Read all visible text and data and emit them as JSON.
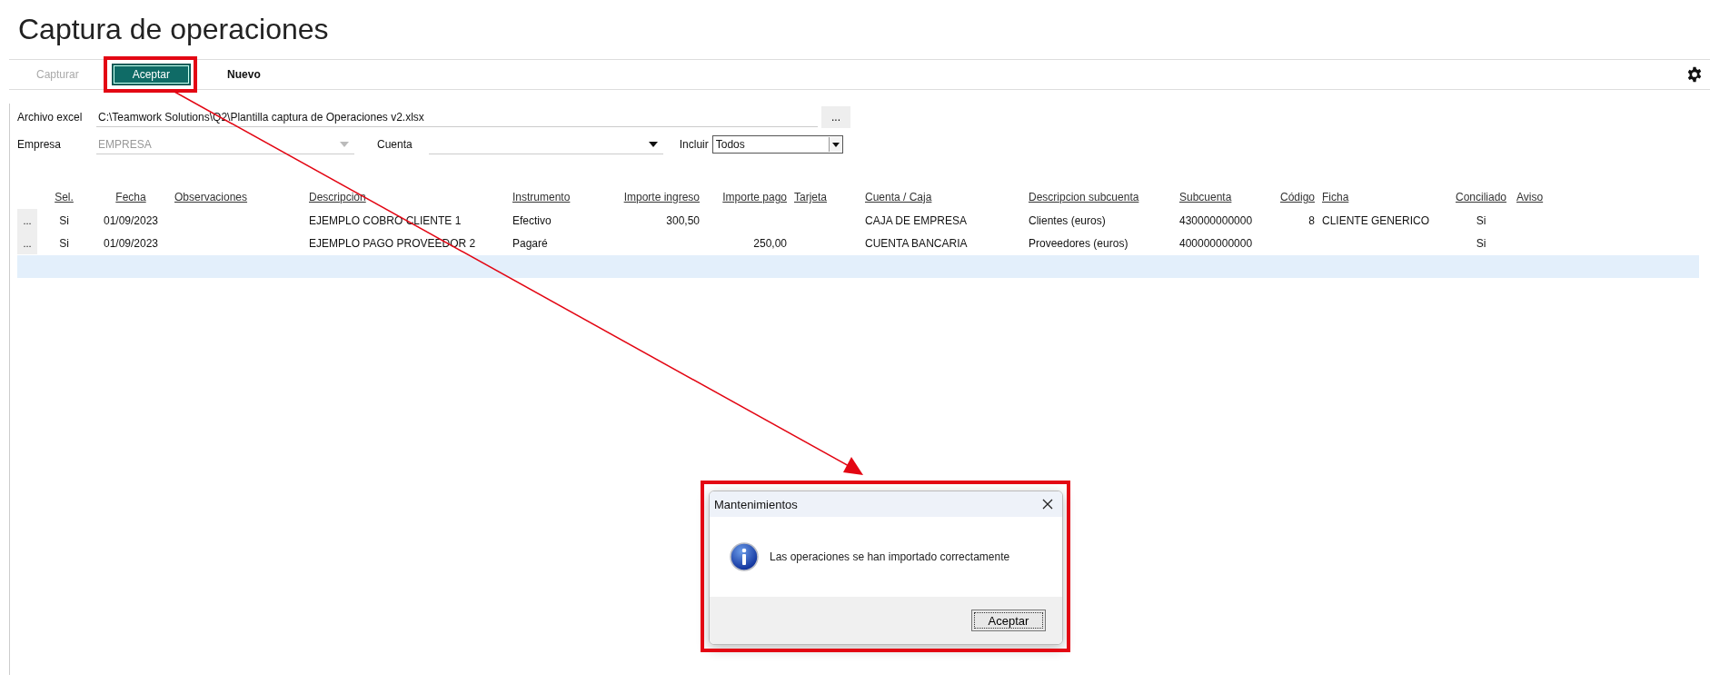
{
  "title": "Captura de operaciones",
  "toolbar": {
    "buttons": [
      {
        "label": "Capturar",
        "disabled": true,
        "primary": false
      },
      {
        "label": "Aceptar",
        "disabled": false,
        "primary": true
      },
      {
        "label": "Nuevo",
        "disabled": false,
        "primary": false
      }
    ]
  },
  "form": {
    "archivo_excel": {
      "label": "Archivo excel",
      "value": "C:\\Teamwork Solutions\\Q2\\Plantilla captura de Operaciones v2.xlsx",
      "browse_button": "..."
    },
    "empresa": {
      "label": "Empresa",
      "value": "EMPRESA",
      "disabled": true
    },
    "cuenta": {
      "label": "Cuenta",
      "disabled": false
    },
    "incluir": {
      "label": "Incluir",
      "value": "Todos"
    }
  },
  "table": {
    "columns": [
      {
        "label": "Sel."
      },
      {
        "label": "Fecha"
      },
      {
        "label": "Observaciones"
      },
      {
        "label": "Descripción"
      },
      {
        "label": "Instrumento"
      },
      {
        "label": "Importe ingreso"
      },
      {
        "label": "Importe pago"
      },
      {
        "label": "Tarjeta"
      },
      {
        "label": "Cuenta / Caja"
      },
      {
        "label": "Descripcion subcuenta"
      },
      {
        "label": "Subcuenta"
      },
      {
        "label": "Código"
      },
      {
        "label": "Ficha"
      },
      {
        "label": "Conciliado"
      },
      {
        "label": "Aviso"
      }
    ],
    "rows": [
      {
        "handle": "...",
        "sel": "Si",
        "fecha": "01/09/2023",
        "descripcion": "EJEMPLO COBRO CLIENTE 1",
        "instrumento": "Efectivo",
        "importe_ingreso": "300,50",
        "cuenta_caja": "CAJA DE EMPRESA",
        "descripcion_subcuenta": "Clientes (euros)",
        "subcuenta": "430000000000",
        "codigo": "8",
        "ficha": "CLIENTE GENERICO",
        "conciliado": "Si"
      },
      {
        "handle": "...",
        "sel": "Si",
        "fecha": "01/09/2023",
        "descripcion": "EJEMPLO PAGO PROVEEDOR 2",
        "instrumento": "Pagaré",
        "importe_pago": "250,00",
        "cuenta_caja": "CUENTA BANCARIA",
        "descripcion_subcuenta": "Proveedores (euros)",
        "subcuenta": "400000000000",
        "conciliado": "Si"
      }
    ]
  },
  "dialog": {
    "title": "Mantenimientos",
    "message": "Las operaciones se han importado correctamente",
    "button": "Aceptar"
  }
}
